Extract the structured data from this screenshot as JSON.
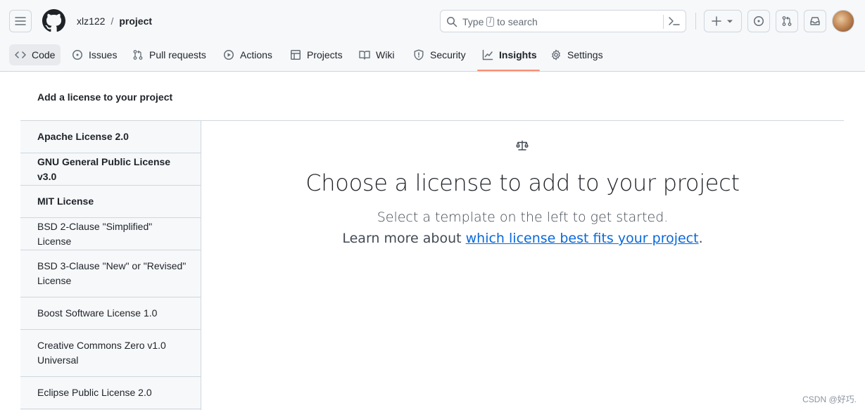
{
  "header": {
    "breadcrumb": {
      "owner": "xlz122",
      "separator": "/",
      "repo": "project"
    },
    "search": {
      "prefix": "Type",
      "key": "/",
      "suffix": "to search"
    }
  },
  "nav": {
    "tabs": [
      {
        "label": "Code",
        "icon": "code-icon"
      },
      {
        "label": "Issues",
        "icon": "issue-icon"
      },
      {
        "label": "Pull requests",
        "icon": "pull-request-icon"
      },
      {
        "label": "Actions",
        "icon": "play-icon"
      },
      {
        "label": "Projects",
        "icon": "table-icon"
      },
      {
        "label": "Wiki",
        "icon": "book-icon"
      },
      {
        "label": "Security",
        "icon": "shield-icon"
      },
      {
        "label": "Insights",
        "icon": "graph-icon",
        "active": true
      },
      {
        "label": "Settings",
        "icon": "gear-icon"
      }
    ],
    "active_color": "#fd8c73"
  },
  "page": {
    "title": "Add a license to your project"
  },
  "licenses": [
    {
      "label": "Apache License 2.0",
      "bold": true
    },
    {
      "label": "GNU General Public License v3.0",
      "bold": true
    },
    {
      "label": "MIT License",
      "bold": true
    },
    {
      "label": "BSD 2-Clause \"Simplified\" License",
      "bold": false
    },
    {
      "label": "BSD 3-Clause \"New\" or \"Revised\" License",
      "bold": false
    },
    {
      "label": "Boost Software License 1.0",
      "bold": false
    },
    {
      "label": "Creative Commons Zero v1.0 Universal",
      "bold": false
    },
    {
      "label": "Eclipse Public License 2.0",
      "bold": false
    }
  ],
  "content": {
    "icon": "law-icon",
    "heading": "Choose a license to add to your project",
    "subtitle": "Select a template on the left to get started.",
    "learn_prefix": "Learn more about ",
    "learn_link": "which license best fits your project",
    "learn_suffix": "."
  },
  "watermark": "CSDN @好巧.",
  "colors": {
    "link": "#0969da",
    "border": "#d0d7de",
    "header_bg": "#f6f8fa"
  }
}
